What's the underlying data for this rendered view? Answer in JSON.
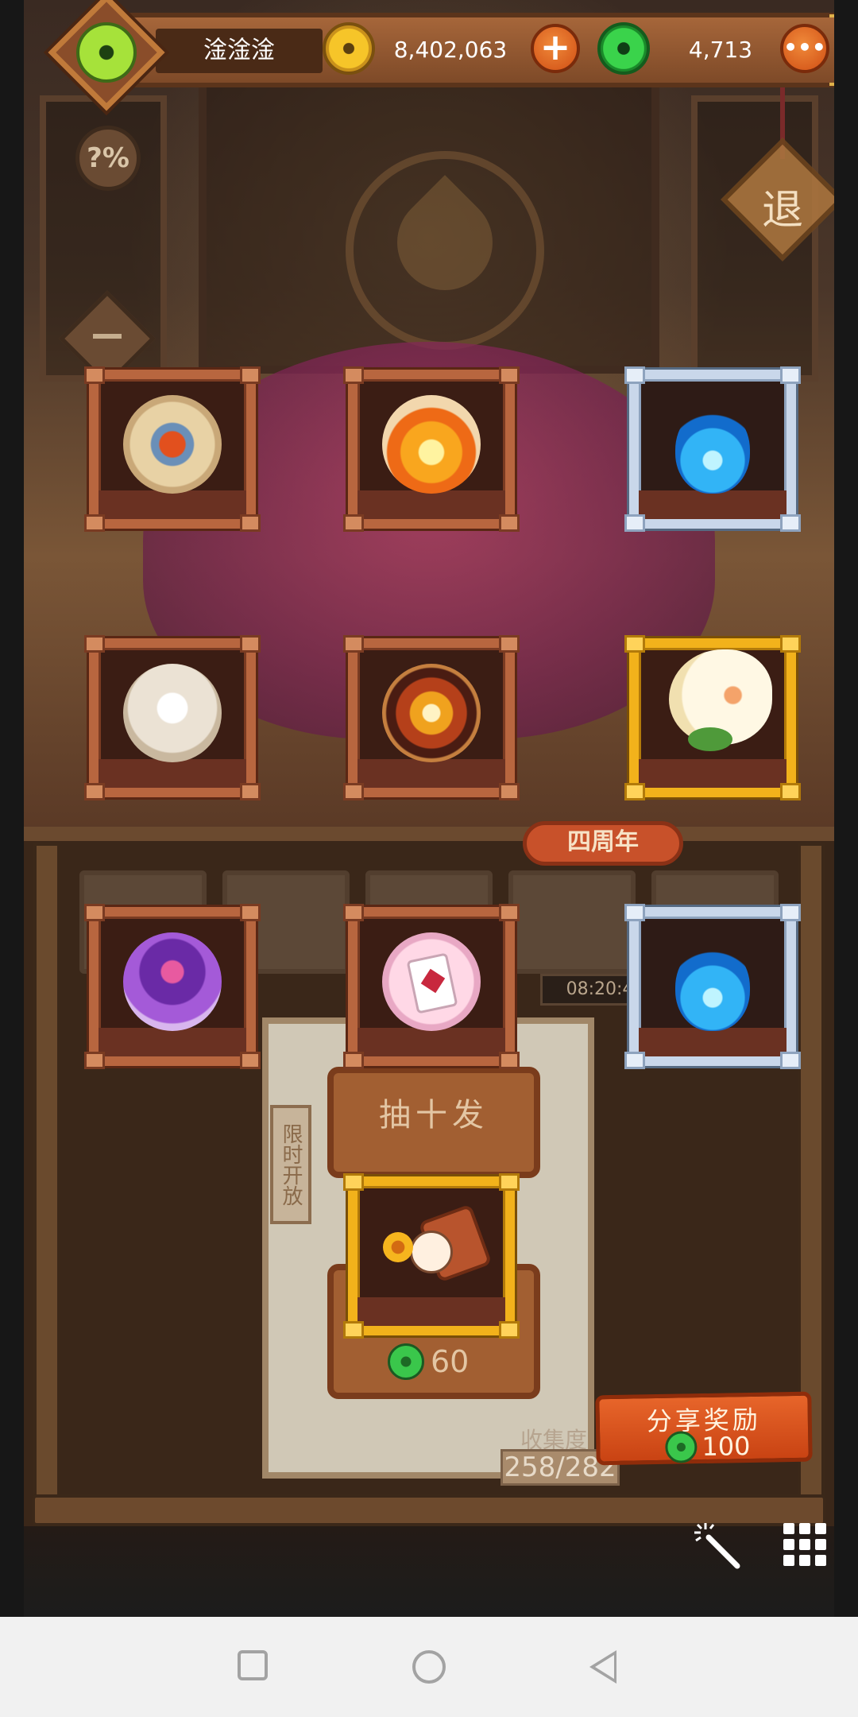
{
  "header": {
    "player_name": "淦淦淦",
    "gold_amount": "8,402,063",
    "jade_amount": "4,713",
    "icons": [
      "avatar-jade-coin-icon",
      "gold-coin-icon",
      "jade-coin-icon",
      "add-gold-icon",
      "more-options-icon"
    ]
  },
  "left_controls": {
    "odds_label": "?%",
    "exit_label": "退"
  },
  "background": {
    "anniversary_badge": "四周年",
    "timer": "08:20:4",
    "limited_tag": "限时开放"
  },
  "draw": {
    "ten_draw_label": "抽十发",
    "single_price": "60"
  },
  "collection": {
    "label": "收集度",
    "count": "258/282"
  },
  "share": {
    "label": "分享奖励",
    "reward": "100"
  },
  "rewards": [
    {
      "rarity": "bronze",
      "icon": "rune-orb-icon"
    },
    {
      "rarity": "bronze",
      "icon": "flame-orb-icon"
    },
    {
      "rarity": "silver",
      "icon": "blue-flame-icon"
    },
    {
      "rarity": "bronze",
      "icon": "feather-orb-icon"
    },
    {
      "rarity": "bronze",
      "icon": "fire-spirit-orb-icon"
    },
    {
      "rarity": "gold",
      "icon": "white-fox-spirit-icon"
    },
    {
      "rarity": "bronze",
      "icon": "purple-owl-orb-icon"
    },
    {
      "rarity": "bronze",
      "icon": "diamond-card-orb-icon"
    },
    {
      "rarity": "silver",
      "icon": "blue-flame-icon"
    },
    {
      "rarity": "gold",
      "icon": "chibi-character-icon"
    }
  ],
  "colors": {
    "bronze_frame": "#b8663f",
    "silver_frame": "#c9d7ea",
    "gold_frame": "#f2b21b",
    "jade": "#3ad34b",
    "gold_coin": "#f6c529",
    "share_button": "#e7652a"
  },
  "system_nav": {
    "icons": [
      "recent-apps-icon",
      "home-icon",
      "back-icon"
    ]
  }
}
